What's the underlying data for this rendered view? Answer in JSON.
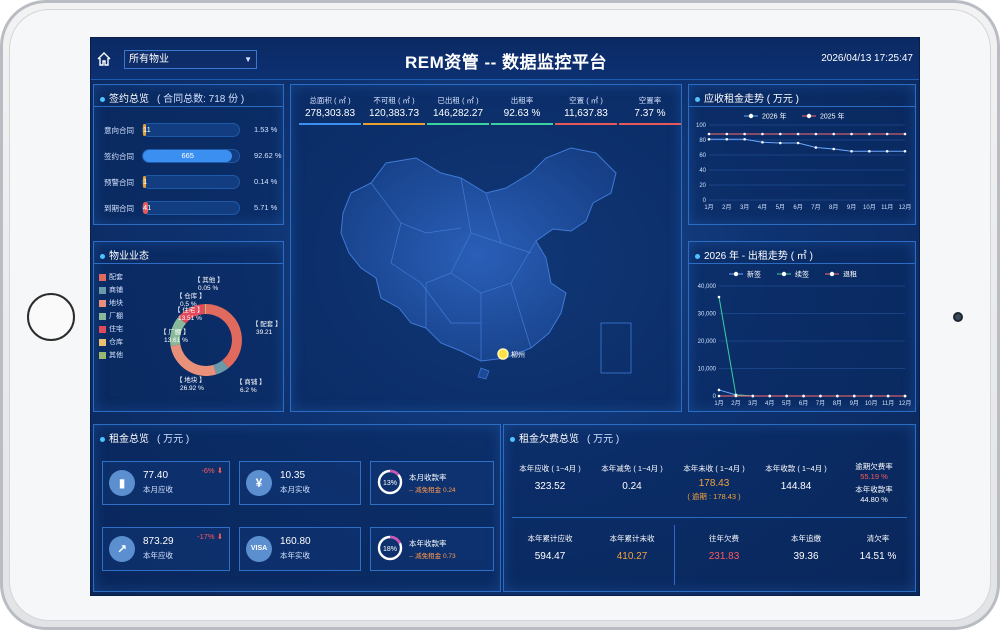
{
  "header": {
    "property_select": "所有物业",
    "title": "REM资管 -- 数据监控平台",
    "datetime": "2026/04/13 17:25:47"
  },
  "contracts": {
    "title": "签约总览",
    "total_label": "( 合同总数: 718 份 )",
    "rows": [
      {
        "label": "意向合同",
        "count": "11",
        "pct": "1.53 %",
        "ratio": 0.0153,
        "color": "#e8a030"
      },
      {
        "label": "签约合同",
        "count": "665",
        "pct": "92.62 %",
        "ratio": 0.9262,
        "color": "#3b8ff0"
      },
      {
        "label": "预警合同",
        "count": "1",
        "pct": "0.14 %",
        "ratio": 0.0014,
        "color": "#e8a030"
      },
      {
        "label": "到期合同",
        "count": "41",
        "pct": "5.71 %",
        "ratio": 0.0571,
        "color": "#e85a5a"
      }
    ]
  },
  "formats": {
    "title": "物业业态",
    "legend": [
      {
        "name": "配套",
        "color": "#e06a5e"
      },
      {
        "name": "商铺",
        "color": "#6a9aa8"
      },
      {
        "name": "地块",
        "color": "#e8907a"
      },
      {
        "name": "厂棚",
        "color": "#8ab89a"
      },
      {
        "name": "住宅",
        "color": "#e04a5a"
      },
      {
        "name": "仓库",
        "color": "#e8c070"
      },
      {
        "name": "其他",
        "color": "#9ab870"
      }
    ],
    "labels": [
      {
        "name": "【 其他 】",
        "pct": "0.05 %"
      },
      {
        "name": "【 仓库 】",
        "pct": "0.5 %"
      },
      {
        "name": "【 住宅 】",
        "pct": "13.51 %"
      },
      {
        "name": "【 厂棚 】",
        "pct": "13.61 %"
      },
      {
        "name": "【 配套 】",
        "pct": "39.21"
      },
      {
        "name": "【 地块 】",
        "pct": "26.92 %"
      },
      {
        "name": "【 商铺 】",
        "pct": "6.2 %"
      }
    ],
    "slices": [
      {
        "name": "配套",
        "value": 39.21,
        "color": "#e06a5e"
      },
      {
        "name": "商铺",
        "value": 6.2,
        "color": "#6a9aa8"
      },
      {
        "name": "地块",
        "value": 26.92,
        "color": "#e8907a"
      },
      {
        "name": "厂棚",
        "value": 13.61,
        "color": "#8ab89a"
      },
      {
        "name": "住宅",
        "value": 13.51,
        "color": "#e04a5a"
      },
      {
        "name": "仓库",
        "value": 0.5,
        "color": "#e8c070"
      },
      {
        "name": "其他",
        "value": 0.05,
        "color": "#9ab870"
      }
    ]
  },
  "kpis": [
    {
      "label": "总面积 ( ㎡ )",
      "value": "278,303.83",
      "color": "#3b8ff0"
    },
    {
      "label": "不可租 ( ㎡ )",
      "value": "120,383.73",
      "color": "#e8a030"
    },
    {
      "label": "已出租 ( ㎡ )",
      "value": "146,282.27",
      "color": "#3bd0a0"
    },
    {
      "label": "出租率",
      "value": "92.63 %",
      "color": "#3bd0a0"
    },
    {
      "label": "空置 ( ㎡ )",
      "value": "11,637.83",
      "color": "#e85a5a"
    },
    {
      "label": "空置率",
      "value": "7.37 %",
      "color": "#e85a5a"
    }
  ],
  "map": {
    "city_label": "柳州"
  },
  "rent_trend": {
    "title": "应收租金走势 ( 万元 )",
    "months": [
      "1月",
      "2月",
      "3月",
      "4月",
      "5月",
      "6月",
      "7月",
      "8月",
      "9月",
      "10月",
      "11月",
      "12月"
    ],
    "y_ticks": [
      "0",
      "20",
      "40",
      "60",
      "80",
      "100"
    ],
    "series": [
      {
        "name": "2026 年",
        "color": "#6aa8ff",
        "values": [
          81,
          81,
          81,
          77,
          76,
          76,
          70,
          68,
          65,
          65,
          65,
          65
        ]
      },
      {
        "name": "2025 年",
        "color": "#ff6a6a",
        "values": [
          88,
          88,
          88,
          88,
          88,
          88,
          88,
          88,
          88,
          88,
          88,
          88
        ]
      }
    ]
  },
  "rental_trend": {
    "title": "2026 年 - 出租走势 ( ㎡ )",
    "months": [
      "1月",
      "2月",
      "3月",
      "4月",
      "5月",
      "6月",
      "7月",
      "8月",
      "9月",
      "10月",
      "11月",
      "12月"
    ],
    "y_ticks": [
      "0",
      "10,000",
      "20,000",
      "30,000",
      "40,000"
    ],
    "series": [
      {
        "name": "新签",
        "color": "#6aa8ff",
        "values": [
          2200,
          400,
          0,
          0,
          0,
          0,
          0,
          0,
          0,
          0,
          0,
          0
        ]
      },
      {
        "name": "续签",
        "color": "#3bd0a0",
        "values": [
          36000,
          400,
          0,
          0,
          0,
          0,
          0,
          0,
          0,
          0,
          0,
          0
        ]
      },
      {
        "name": "退租",
        "color": "#ff6a6a",
        "values": [
          0,
          0,
          0,
          0,
          0,
          0,
          0,
          0,
          0,
          0,
          0,
          0
        ]
      }
    ]
  },
  "rent_overview": {
    "title": "租金总览",
    "unit": "( 万元 )",
    "cards": [
      {
        "value": "77.40",
        "label": "本月应收",
        "change": "-6%"
      },
      {
        "value": "10.35",
        "label": "本月实收"
      },
      {
        "ring": "13%",
        "label": "本月收款率",
        "sub": "-- 减免租金 0.24"
      },
      {
        "value": "873.29",
        "label": "本年应收",
        "change": "-17%"
      },
      {
        "value": "160.80",
        "label": "本年实收"
      },
      {
        "ring": "18%",
        "label": "本年收款率",
        "sub": "-- 减免租金 0.73"
      }
    ]
  },
  "arrears": {
    "title": "租金欠费总览",
    "unit": "( 万元 )",
    "top": [
      {
        "label": "本年应收 ( 1~4月 )",
        "value": "323.52"
      },
      {
        "label": "本年减免 ( 1~4月 )",
        "value": "0.24"
      },
      {
        "label": "本年未收 ( 1~4月 )",
        "value": "178.43",
        "extra": "( 逾期 : 178.43 )"
      },
      {
        "label": "本年收款 ( 1~4月 )",
        "value": "144.84"
      },
      {
        "label": "逾期欠费率",
        "value": "55.19 %",
        "label2": "本年收款率",
        "value2": "44.80 %"
      }
    ],
    "bottom": [
      {
        "label": "本年累计应收",
        "value": "594.47"
      },
      {
        "label": "本年累计未收",
        "value": "410.27"
      },
      {
        "label": "往年欠费",
        "value": "231.83"
      },
      {
        "label": "本年追缴",
        "value": "39.36"
      },
      {
        "label": "清欠率",
        "value": "14.51 %"
      }
    ]
  }
}
